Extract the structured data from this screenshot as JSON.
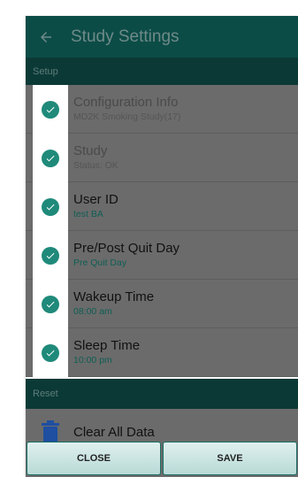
{
  "appbar": {
    "title": "Study Settings",
    "back_icon": "arrow-left-icon"
  },
  "sections": {
    "setup": "Setup",
    "reset": "Reset"
  },
  "settings": [
    {
      "label": "Configuration Info",
      "value": "MD2K Smoking Study(17)",
      "icon": "check-circle-icon"
    },
    {
      "label": "Study",
      "value": "Status: OK",
      "icon": "check-circle-icon"
    },
    {
      "label": "User ID",
      "value": "test BA",
      "icon": "check-circle-icon"
    },
    {
      "label": "Pre/Post Quit Day",
      "value": "Pre Quit Day",
      "icon": "check-circle-icon"
    },
    {
      "label": "Wakeup Time",
      "value": "08:00 am",
      "icon": "check-circle-icon"
    },
    {
      "label": "Sleep Time",
      "value": "10:00 pm",
      "icon": "check-circle-icon"
    }
  ],
  "reset_action": {
    "label": "Clear All Data",
    "icon": "trash-icon"
  },
  "buttons": {
    "close": "CLOSE",
    "save": "SAVE"
  },
  "colors": {
    "appbar": "#0c4c47",
    "section_header": "#0b3a36",
    "check": "#1f8a7a",
    "trash": "#1e4fa0",
    "button_border": "#1b6f65"
  }
}
